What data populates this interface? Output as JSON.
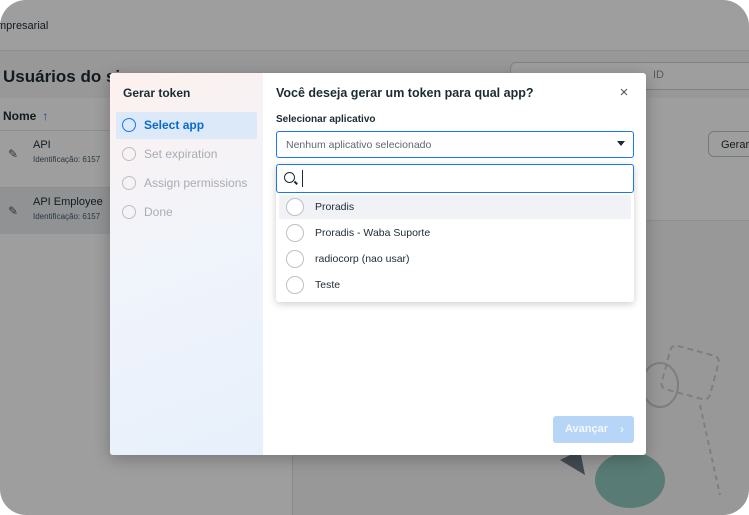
{
  "background": {
    "topbar_text": "mpresarial",
    "page_title": "Usuários do sis",
    "search_placeholder": "ID",
    "column_header": "Nome",
    "rows": [
      {
        "title": "API",
        "subtitle": "Identificação: 6157"
      },
      {
        "title": "API Employee",
        "subtitle": "Identificação: 6157"
      }
    ],
    "action_button": "Gerar"
  },
  "modal": {
    "sidebar_title": "Gerar token",
    "steps": [
      {
        "label": "Select app",
        "active": true
      },
      {
        "label": "Set expiration",
        "active": false
      },
      {
        "label": "Assign permissions",
        "active": false
      },
      {
        "label": "Done",
        "active": false
      }
    ],
    "question": "Você deseja gerar um token para qual app?",
    "close_icon": "×",
    "field_label": "Selecionar aplicativo",
    "select_value": "Nenhum aplicativo selecionado",
    "search_value": "",
    "options": [
      {
        "label": "Proradis"
      },
      {
        "label": "Proradis - Waba Suporte"
      },
      {
        "label": "radiocorp (nao usar)"
      },
      {
        "label": "Teste"
      }
    ],
    "next_button": "Avançar"
  },
  "colors": {
    "accent": "#1877f2",
    "active_step_text": "#0a6acb",
    "disabled_button": "#b7d5f6"
  }
}
